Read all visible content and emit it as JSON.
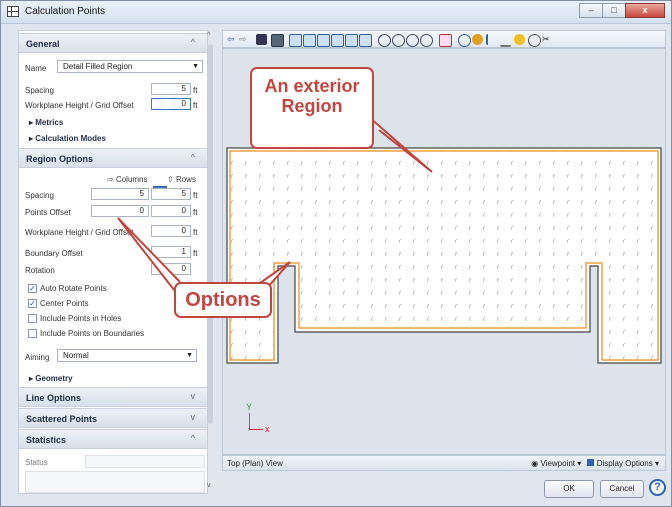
{
  "window": {
    "title": "Calculation Points",
    "min": "–",
    "max": "□",
    "close": "x"
  },
  "general": {
    "header": "General",
    "name_label": "Name",
    "name_value": "Detail Filled Region",
    "spacing_label": "Spacing",
    "spacing_value": "5",
    "spacing_unit": "ft",
    "wp_label": "Workplane Height / Grid Offset",
    "wp_value": "0",
    "wp_unit": "ft",
    "metrics": "Metrics",
    "calc_modes": "Calculation Modes"
  },
  "region": {
    "header": "Region Options",
    "columns": "Columns",
    "rows": "Rows",
    "spacing_label": "Spacing",
    "spacing_col": "5",
    "spacing_row": "5",
    "spacing_unit": "ft",
    "points_offset_label": "Points Offset",
    "points_offset_col": "0",
    "points_offset_row": "0",
    "points_offset_unit": "ft",
    "wp_label": "Workplane Height / Grid Offset",
    "wp_value": "0",
    "wp_unit": "ft",
    "boundary_label": "Boundary Offset",
    "boundary_value": "1",
    "boundary_unit": "ft",
    "rotation_label": "Rotation",
    "rotation_value": "0",
    "checks": [
      {
        "label": "Auto Rotate Points",
        "checked": true
      },
      {
        "label": "Center Points",
        "checked": true
      },
      {
        "label": "Include Points in Holes",
        "checked": false
      },
      {
        "label": "Include Points on Boundaries",
        "checked": false
      }
    ],
    "aiming_label": "Aiming",
    "aiming_value": "Normal",
    "geometry": "Geometry"
  },
  "sections": {
    "line": "Line Options",
    "scattered": "Scattered Points",
    "statistics": "Statistics"
  },
  "status_label": "Status",
  "view": {
    "name": "Top (Plan) View",
    "viewpoint": "Viewpoint",
    "display_options": "Display Options",
    "axis_y": "Y",
    "axis_x": "x"
  },
  "buttons": {
    "ok": "OK",
    "cancel": "Cancel",
    "help": "?"
  },
  "callouts": {
    "region": "An exterior Region",
    "options": "Options"
  },
  "colors": {
    "callout": "#c2463f",
    "region_outline": "#f0a040"
  }
}
